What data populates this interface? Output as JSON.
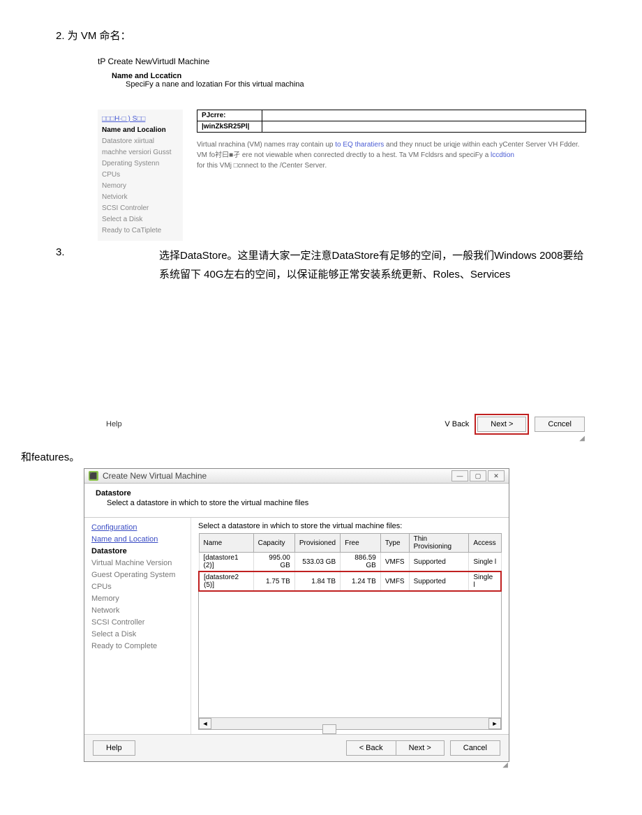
{
  "doc": {
    "step2_heading": "2. 为 VM 命名：",
    "step3_num": "3.",
    "overlay_text": "选择DataStore。这里请大家一定注意DataStore有足够的空间，一般我们Windows 2008要给系统留下 40G左右的空间，以保证能够正常安装系统更新、Roles、Services",
    "between_text": "和features。"
  },
  "wizard1": {
    "window_title": "tP Create NewVirtudl Machine",
    "header_title": "Name and Lccaticn",
    "header_sub": "SpeciFy a nane and lozatian For this virtual machina",
    "sidebar": {
      "link": "□□□H·□ ) S□□",
      "items": [
        "Name and Localion",
        "Datastore xiirtual machhe versiori Gusst Dperating Systenn CPUs",
        "Nemory",
        "Netviork",
        "SCSI Controler",
        "Select a Disk",
        "Ready to CaTiplete"
      ]
    },
    "name_label": "PJcrre:",
    "name_value": "|winZkSR25Pl|",
    "hint1_pre": "Virtual nrachina (VM) names rray contain up ",
    "hint1_link": "to EQ tharatiers",
    "hint1_post": " and they nnuct be uriqje within each yCenter Server VH Fdder.",
    "hint2_pre": "VM fo衬曰■孑 ere not viewable when conrected drectly to a hest. Ta         VM Fcldsrs and speciFy a ",
    "hint2_link": "lccdtion",
    "hint3": "for this VMj □cnnect to the /Center Server.",
    "footer": {
      "help": "Help",
      "back": "V Back",
      "next": "Next >",
      "cancel": "Ccncel"
    }
  },
  "wizard2": {
    "window_title": "Create New Virtual Machine",
    "header_title": "Datastore",
    "header_sub": "Select a datastore in which to store the virtual machine files",
    "sidebar": [
      "Configuration",
      "Name and Location",
      "Datastore",
      "Virtual Machine Version",
      "Guest Operating System",
      "CPUs",
      "Memory",
      "Network",
      "SCSI Controller",
      "Select a Disk",
      "Ready to Complete"
    ],
    "main_label": "Select a datastore in which to store the virtual machine files:",
    "columns": [
      "Name",
      "Capacity",
      "Provisioned",
      "Free",
      "Type",
      "Thin Provisioning",
      "Access"
    ],
    "rows": [
      {
        "name": "[datastore1 (2)]",
        "capacity": "995.00 GB",
        "provisioned": "533.03 GB",
        "free": "886.59 GB",
        "type": "VMFS",
        "thin": "Supported",
        "access": "Single l"
      },
      {
        "name": "[datastore2 (5)]",
        "capacity": "1.75 TB",
        "provisioned": "1.84 TB",
        "free": "1.24 TB",
        "type": "VMFS",
        "thin": "Supported",
        "access": "Single l"
      }
    ],
    "footer": {
      "help": "Help",
      "back": "< Back",
      "next": "Next >",
      "cancel": "Cancel"
    }
  }
}
